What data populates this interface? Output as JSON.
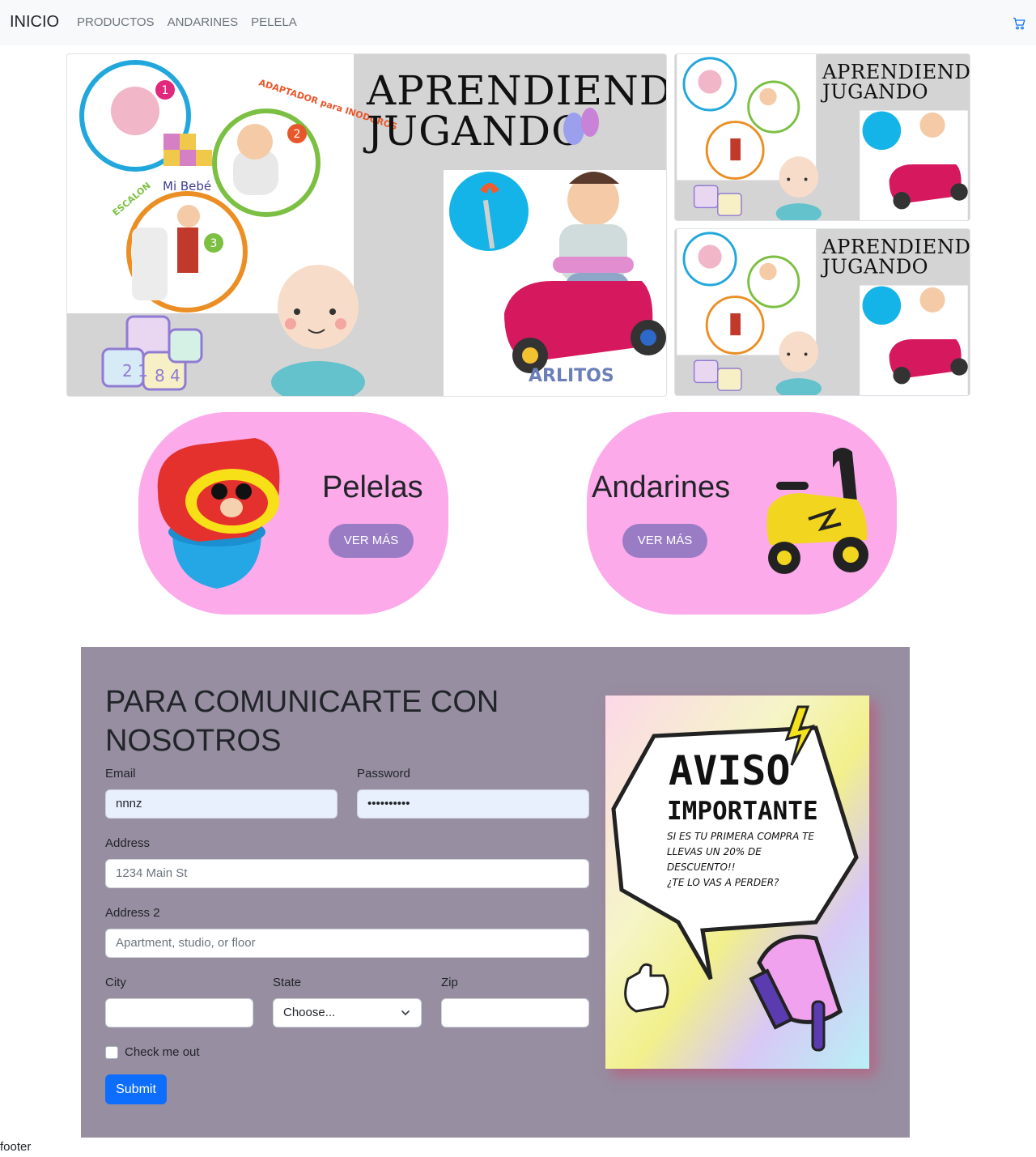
{
  "navbar": {
    "brand": "INICIO",
    "links": [
      "PRODUCTOS",
      "ANDARINES",
      "PELELA"
    ],
    "cart_icon": "cart-icon"
  },
  "banner": {
    "title_line1": "APRENDIENDO",
    "title_line2": "JUGANDO",
    "labels": {
      "adaptador": "ADAPTADOR para INODOROS",
      "escalon": "ESCALON",
      "mibebe": "Mi Bebé",
      "mi": "MI",
      "bebe": "BEBE",
      "brand_watermark": "ARLITOS"
    }
  },
  "categories": [
    {
      "title": "Pelelas",
      "button": "VER MÁS"
    },
    {
      "title": "Andarines",
      "button": "VER MÁS"
    }
  ],
  "contact": {
    "heading": "PARA COMUNICARTE CON NOSOTROS",
    "email_label": "Email",
    "email_value": "nnnz",
    "password_label": "Password",
    "password_value": "••••••••••",
    "address_label": "Address",
    "address_placeholder": "1234 Main St",
    "address2_label": "Address 2",
    "address2_placeholder": "Apartment, studio, or floor",
    "city_label": "City",
    "state_label": "State",
    "state_selected": "Choose...",
    "zip_label": "Zip",
    "checkbox_label": "Check me out",
    "submit_label": "Submit"
  },
  "aviso": {
    "title1": "AVISO",
    "title2": "IMPORTANTE",
    "line1": "SI ES TU PRIMERA COMPRA TE",
    "line2": "LLEVAS UN 20%  DE",
    "line3": "DESCUENTO!!",
    "line4": "¿TE LO VAS A PERDER?"
  },
  "footer": {
    "text": "footer"
  },
  "colors": {
    "card_pink": "#fcaaea",
    "button_purple": "#9a7cc5",
    "contact_bg": "#978ea1",
    "submit_blue": "#0d6efd"
  }
}
